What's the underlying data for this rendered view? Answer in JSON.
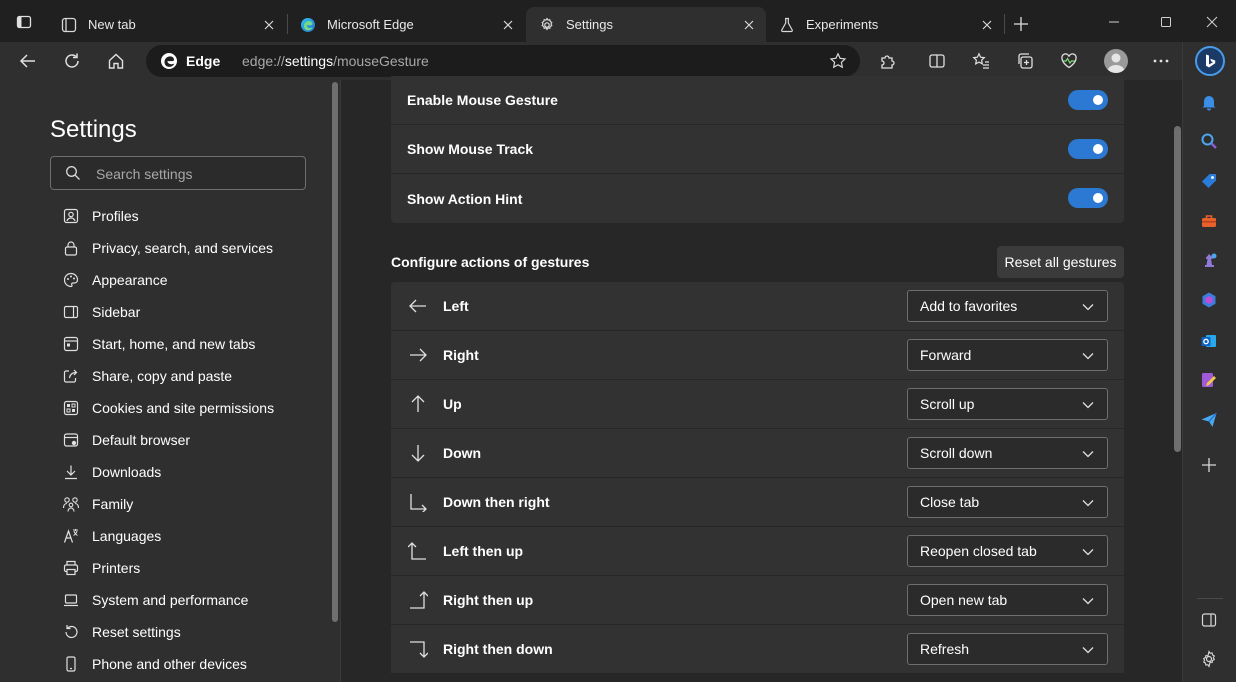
{
  "tabs": [
    {
      "title": "New tab",
      "icon": "new-tab-page-icon"
    },
    {
      "title": "Microsoft Edge",
      "icon": "edge-logo-icon"
    },
    {
      "title": "Settings",
      "icon": "gear-icon"
    },
    {
      "title": "Experiments",
      "icon": "flask-icon"
    }
  ],
  "address": {
    "site_label": "Edge",
    "url_prefix": "edge://",
    "url_host": "settings",
    "url_path": "/mouseGesture"
  },
  "settings": {
    "title": "Settings",
    "search_placeholder": "Search settings",
    "nav": [
      {
        "label": "Profiles",
        "icon": "profile-icon"
      },
      {
        "label": "Privacy, search, and services",
        "icon": "lock-icon"
      },
      {
        "label": "Appearance",
        "icon": "palette-icon"
      },
      {
        "label": "Sidebar",
        "icon": "sidebar-icon"
      },
      {
        "label": "Start, home, and new tabs",
        "icon": "home-tab-icon"
      },
      {
        "label": "Share, copy and paste",
        "icon": "share-icon"
      },
      {
        "label": "Cookies and site permissions",
        "icon": "cookie-icon"
      },
      {
        "label": "Default browser",
        "icon": "browser-icon"
      },
      {
        "label": "Downloads",
        "icon": "download-icon"
      },
      {
        "label": "Family",
        "icon": "family-icon"
      },
      {
        "label": "Languages",
        "icon": "language-icon"
      },
      {
        "label": "Printers",
        "icon": "printer-icon"
      },
      {
        "label": "System and performance",
        "icon": "laptop-icon"
      },
      {
        "label": "Reset settings",
        "icon": "reset-icon"
      },
      {
        "label": "Phone and other devices",
        "icon": "phone-icon"
      }
    ]
  },
  "mouse_gesture": {
    "toggles": [
      {
        "label": "Enable Mouse Gesture",
        "on": true
      },
      {
        "label": "Show Mouse Track",
        "on": true
      },
      {
        "label": "Show Action Hint",
        "on": true
      }
    ],
    "section_title": "Configure actions of gestures",
    "reset_label": "Reset all gestures",
    "gestures": [
      {
        "label": "Left",
        "action": "Add to favorites",
        "icon": "arrow-left-icon"
      },
      {
        "label": "Right",
        "action": "Forward",
        "icon": "arrow-right-icon"
      },
      {
        "label": "Up",
        "action": "Scroll up",
        "icon": "arrow-up-icon"
      },
      {
        "label": "Down",
        "action": "Scroll down",
        "icon": "arrow-down-icon"
      },
      {
        "label": "Down then right",
        "action": "Close tab",
        "icon": "arrow-down-right-icon"
      },
      {
        "label": "Left then up",
        "action": "Reopen closed tab",
        "icon": "arrow-left-up-icon"
      },
      {
        "label": "Right then up",
        "action": "Open new tab",
        "icon": "arrow-right-up-icon"
      },
      {
        "label": "Right then down",
        "action": "Refresh",
        "icon": "arrow-right-down-icon"
      }
    ]
  },
  "colors": {
    "accent": "#2c79d4",
    "background": "#272727",
    "panel": "#2f2f2f",
    "card": "#323232"
  }
}
